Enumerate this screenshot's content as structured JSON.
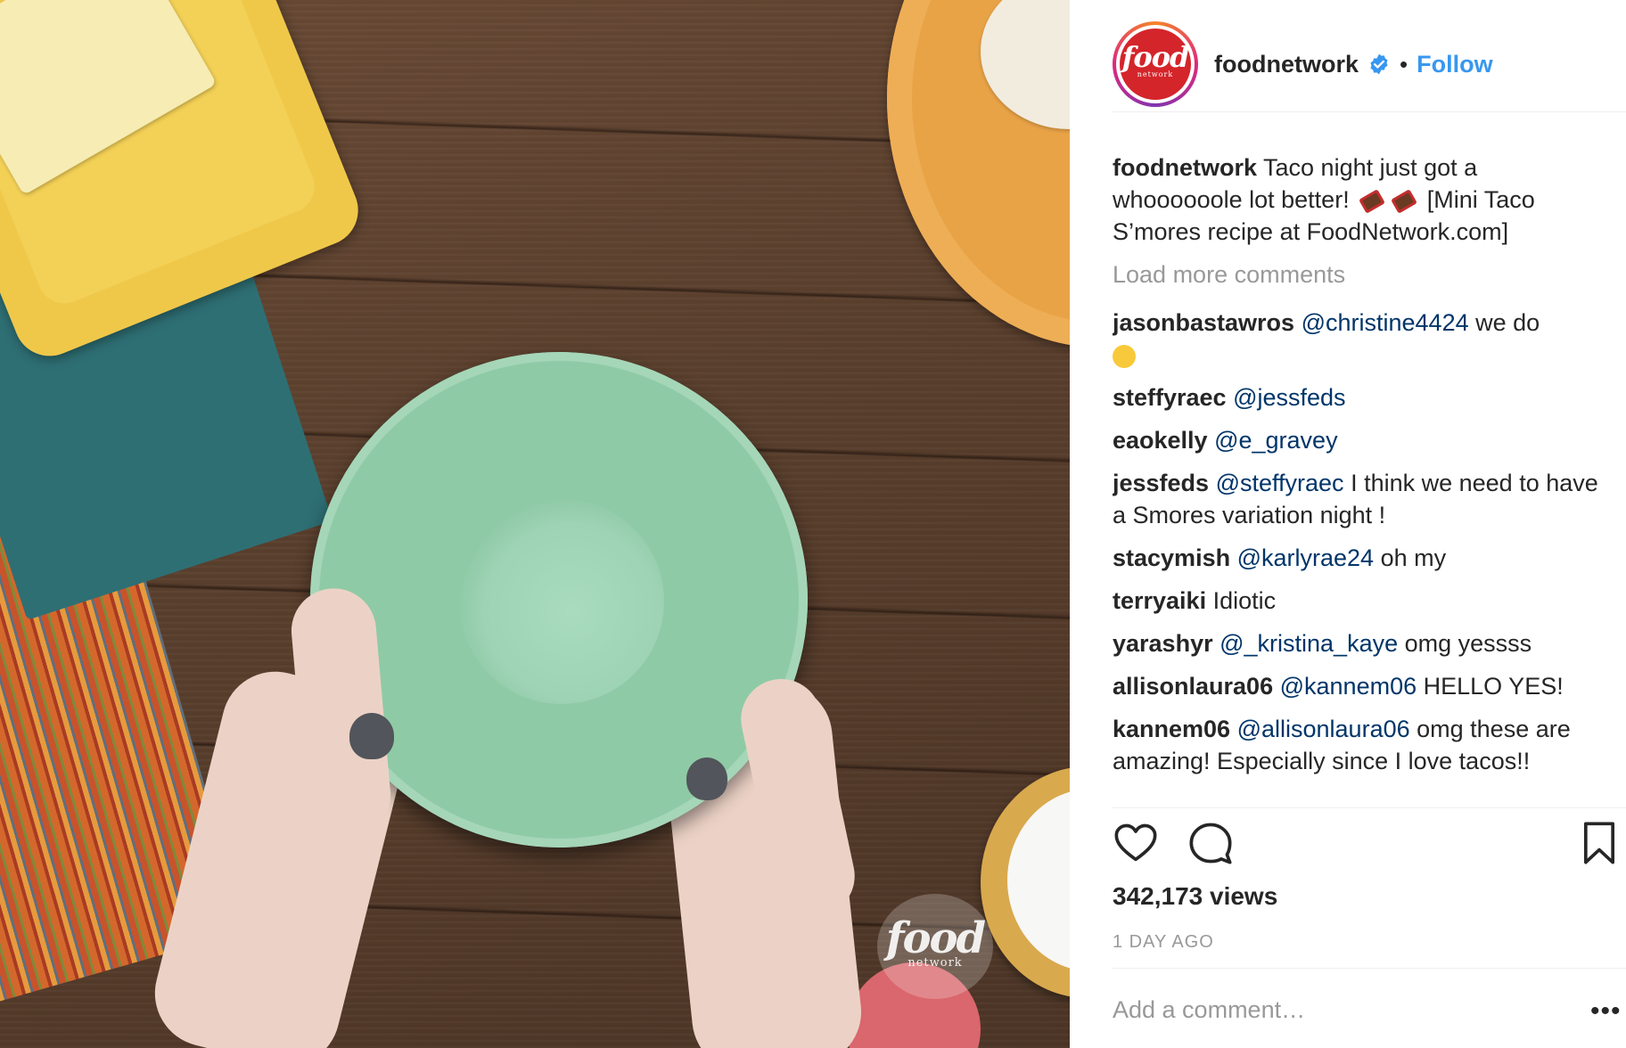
{
  "post": {
    "username": "foodnetwork",
    "follow_label": "Follow",
    "separator": "•",
    "avatar_text": "food",
    "avatar_subtext": "network",
    "watermark_text": "food",
    "watermark_subtext": "network"
  },
  "caption": {
    "username": "foodnetwork",
    "text_before": "Taco night just got a whoooooole lot better!",
    "text_after": "[Mini Taco S’mores recipe at FoodNetwork.com]"
  },
  "load_more": "Load more comments",
  "comments": [
    {
      "user": "jasonbastawros",
      "mention": "@christine4424",
      "text": "we do"
    },
    {
      "user": "steffyraec",
      "mention": "@jessfeds",
      "text": ""
    },
    {
      "user": "eaokelly",
      "mention": "@e_gravey",
      "text": ""
    },
    {
      "user": "jessfeds",
      "mention": "@steffyraec",
      "text": "I think we need to have a Smores variation night !"
    },
    {
      "user": "stacymish",
      "mention": "@karlyrae24",
      "text": "oh my"
    },
    {
      "user": "terryaiki",
      "mention": "",
      "text": "Idiotic"
    },
    {
      "user": "yarashyr",
      "mention": "@_kristina_kaye",
      "text": "omg yessss"
    },
    {
      "user": "allisonlaura06",
      "mention": "@kannem06",
      "text": "HELLO YES!"
    },
    {
      "user": "kannem06",
      "mention": "@allisonlaura06",
      "text": "omg these are amazing! Especially since I love tacos!!"
    }
  ],
  "stats": {
    "views": "342,173 views",
    "time_ago": "1 DAY AGO"
  },
  "composer": {
    "placeholder": "Add a comment…",
    "more": "•••"
  },
  "icons": {
    "like": "heart-icon",
    "comment": "comment-icon",
    "save": "bookmark-icon",
    "verified": "verified-badge-icon"
  },
  "colors": {
    "link": "#3897f0",
    "mention": "#003569",
    "muted": "#999999",
    "text": "#262626"
  }
}
